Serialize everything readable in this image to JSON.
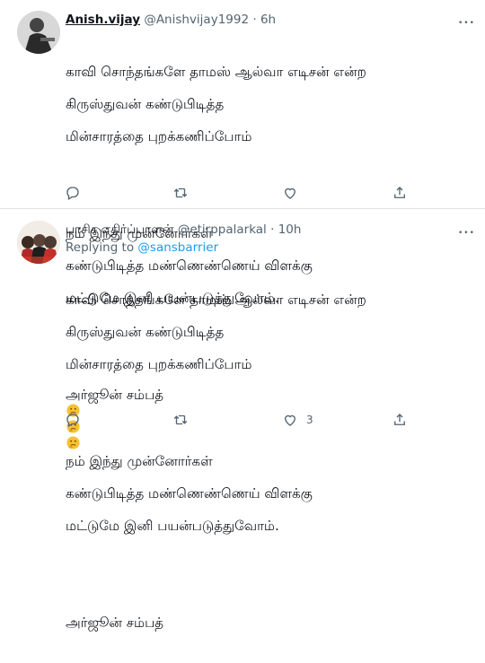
{
  "tweets": [
    {
      "display_name": "Anish.vijay",
      "handle": "@Anishvijay1992",
      "separator": "·",
      "time": "6h",
      "more": "•••",
      "paragraphs": [
        [
          "காவி சொந்தங்களே தாமஸ் ஆல்வா எடிசன் என்ற",
          "கிருஸ்துவன் கண்டுபிடித்த",
          "மின்சாரத்தை புறக்கணிப்போம்"
        ],
        [
          "நம் இந்து முன்னோர்கள்",
          "கண்டுபிடித்த மண்ணெண்ணெய் விளக்கு",
          "மட்டுமே இனி பயன்படுத்துவோம்."
        ],
        [
          "அர்ஜூன் சம்பத்"
        ]
      ],
      "emoji": [
        "thinking-face",
        "thinking-face",
        "thinking-face"
      ],
      "actions": {
        "reply": "",
        "retweet": "",
        "like": "",
        "share": ""
      }
    },
    {
      "display_name": "பாசிச எதிர்ப்பாளன்",
      "handle": "@etirppalarkal",
      "separator": "·",
      "time": "10h",
      "more": "•••",
      "replying_prefix": "Replying to",
      "replying_to": "@sansbarrier",
      "paragraphs": [
        [
          "காவி சொந்தங்களே தாமஸ் ஆல்வா எடிசன் என்ற",
          "கிருஸ்துவன் கண்டுபிடித்த",
          "மின்சாரத்தை புறக்கணிப்போம்"
        ],
        [
          "நம் இந்து முன்னோர்கள்",
          "கண்டுபிடித்த மண்ணெண்ணெய் விளக்கு",
          "மட்டுமே இனி பயன்படுத்துவோம்."
        ],
        [
          "அர்ஜூன் சம்பத்"
        ]
      ],
      "actions": {
        "reply": "",
        "retweet": "",
        "like": "3",
        "share": ""
      }
    }
  ],
  "colors": {
    "link": "#1d9bf0",
    "muted": "#536471",
    "text": "#0f1419",
    "divider": "#dfe3e6"
  }
}
